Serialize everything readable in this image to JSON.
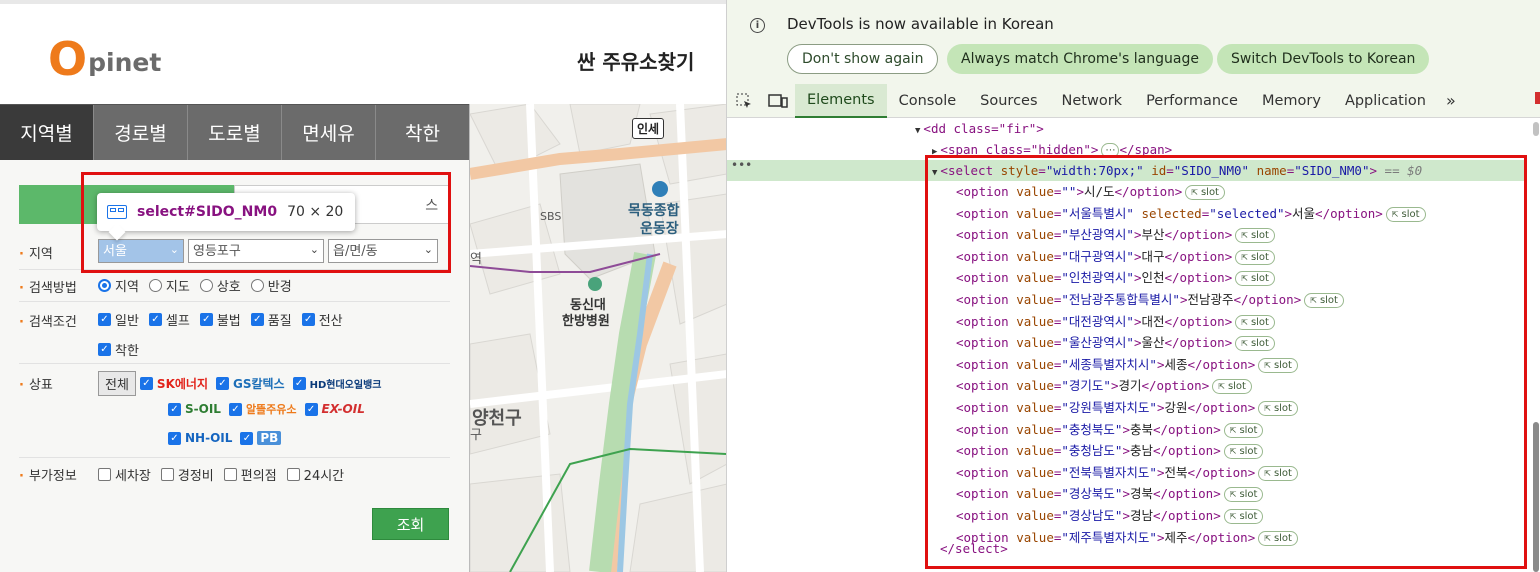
{
  "site": {
    "logo_o": "O",
    "logo_rest": "pinet",
    "page_title": "싼 주유소찾기",
    "tabs": [
      "지역별",
      "경로별",
      "도로별",
      "면세유",
      "착한"
    ],
    "search_type_right": "스",
    "rows": {
      "region_label": "지역",
      "region_select_1": "서울",
      "region_select_2": "영등포구",
      "region_select_3": "읍/면/동",
      "method_label": "검색방법",
      "method_options": [
        "지역",
        "지도",
        "상호",
        "반경"
      ],
      "condition_label": "검색조건",
      "condition_options": [
        "일반",
        "셀프",
        "불법",
        "품질",
        "전산"
      ],
      "condition_options_2": [
        "착한"
      ],
      "brand_label": "상표",
      "brand_all": "전체",
      "brands": [
        "SK에너지",
        "GS칼텍스",
        "HD현대오일뱅크",
        "S-OIL",
        "알뜰주유소",
        "EX-OIL",
        "NH-OIL",
        "PB"
      ],
      "extra_label": "부가정보",
      "extra_options": [
        "세차장",
        "경정비",
        "편의점",
        "24시간"
      ]
    },
    "search_button": "조회",
    "tooltip": {
      "tag": "select",
      "id": "#SIDO_NM0",
      "size": "70 × 20"
    },
    "map_labels": {
      "incheon": "인세",
      "sbs": "SBS",
      "stadium_1": "목동종합",
      "stadium_2": "운동장",
      "hospital_1": "동신대",
      "hospital_2": "한방병원",
      "district": "양천구",
      "edge_1": "역",
      "edge_2": "구"
    }
  },
  "devtools": {
    "info_text": "DevTools is now available in Korean",
    "btn_dont": "Don't show again",
    "btn_always": "Always match Chrome's language",
    "btn_switch": "Switch DevTools to Korean",
    "tabs": [
      "Elements",
      "Console",
      "Sources",
      "Network",
      "Performance",
      "Memory",
      "Application"
    ],
    "more": "»",
    "ellipsis": "•••",
    "code": {
      "dd_open": "<dd class=\"fir\">",
      "span_line_pre": "<span class=\"hidden\">",
      "span_line_dots": "⋯",
      "span_line_post": "</span>",
      "select_pre": "<select ",
      "select_attr1": "style",
      "select_val1": "\"width:70px;\"",
      "select_attr2": "id",
      "select_val2": "\"SIDO_NM0\"",
      "select_attr3": "name",
      "select_val3": "\"SIDO_NM0\"",
      "select_post": ">",
      "eq0": " == $0",
      "select_close": "</select>",
      "slot": "slot",
      "options": [
        {
          "value": "",
          "text": "시/도",
          "selected": false
        },
        {
          "value": "서울특별시",
          "text": "서울",
          "selected": true
        },
        {
          "value": "부산광역시",
          "text": "부산",
          "selected": false
        },
        {
          "value": "대구광역시",
          "text": "대구",
          "selected": false
        },
        {
          "value": "인천광역시",
          "text": "인천",
          "selected": false
        },
        {
          "value": "전남광주통합특별시",
          "text": "전남광주",
          "selected": false
        },
        {
          "value": "대전광역시",
          "text": "대전",
          "selected": false
        },
        {
          "value": "울산광역시",
          "text": "울산",
          "selected": false
        },
        {
          "value": "세종특별자치시",
          "text": "세종",
          "selected": false
        },
        {
          "value": "경기도",
          "text": "경기",
          "selected": false
        },
        {
          "value": "강원특별자치도",
          "text": "강원",
          "selected": false
        },
        {
          "value": "충청북도",
          "text": "충북",
          "selected": false
        },
        {
          "value": "충청남도",
          "text": "충남",
          "selected": false
        },
        {
          "value": "전북특별자치도",
          "text": "전북",
          "selected": false
        },
        {
          "value": "경상북도",
          "text": "경북",
          "selected": false
        },
        {
          "value": "경상남도",
          "text": "경남",
          "selected": false
        },
        {
          "value": "제주특별자치도",
          "text": "제주",
          "selected": false
        }
      ]
    }
  }
}
